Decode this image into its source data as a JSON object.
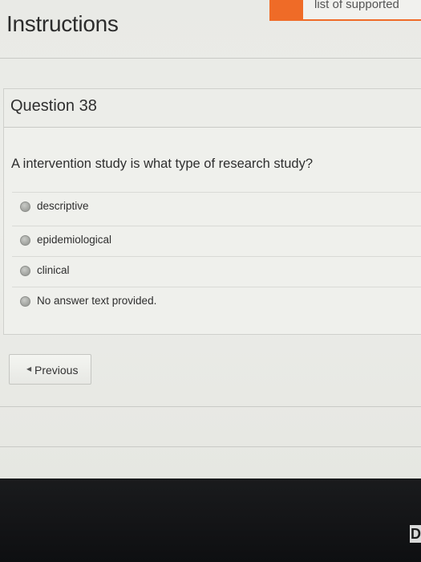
{
  "banner": {
    "text": "list of supported",
    "accent_color": "#ef6b27"
  },
  "page": {
    "title": "Instructions"
  },
  "question": {
    "number_label": "Question 38",
    "text": "A intervention study is what type of research study?",
    "options": [
      {
        "label": "descriptive",
        "selected": false
      },
      {
        "label": "epidemiological",
        "selected": false
      },
      {
        "label": "clinical",
        "selected": false
      },
      {
        "label": "No answer text provided.",
        "selected": false
      }
    ]
  },
  "navigation": {
    "previous_label": "Previous",
    "previous_icon": "left-triangle-icon"
  },
  "bezel": {
    "corner_text": "D"
  }
}
